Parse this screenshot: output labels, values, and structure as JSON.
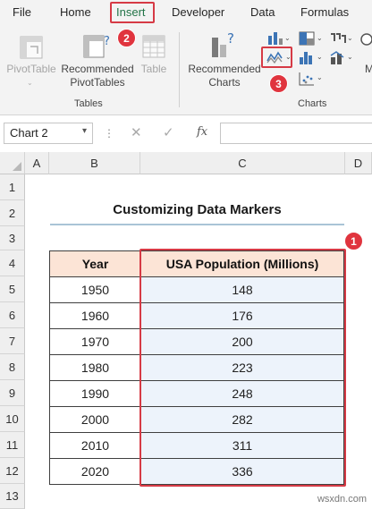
{
  "menu": {
    "items": [
      "File",
      "Home",
      "Insert",
      "Developer",
      "Data",
      "Formulas"
    ],
    "active": "Insert"
  },
  "ribbon": {
    "pivottable": "PivotTable",
    "recommended_pivot_1": "Recommended",
    "recommended_pivot_2": "PivotTables",
    "table": "Table",
    "tables_group": "Tables",
    "recommended_charts_1": "Recommended",
    "recommended_charts_2": "Charts",
    "charts_group": "Charts",
    "cut_off_letter": "M"
  },
  "badges": {
    "one": "1",
    "two": "2",
    "three": "3"
  },
  "formula_bar": {
    "name_box": "Chart 2",
    "fx": "fx"
  },
  "columns": [
    "A",
    "B",
    "C",
    "D"
  ],
  "rows": [
    "1",
    "2",
    "3",
    "4",
    "5",
    "6",
    "7",
    "8",
    "9",
    "10",
    "11",
    "12",
    "13"
  ],
  "sheet": {
    "title": "Customizing Data Markers",
    "headers": [
      "Year",
      "USA Population (Millions)"
    ],
    "data": [
      {
        "year": "1950",
        "pop": "148"
      },
      {
        "year": "1960",
        "pop": "176"
      },
      {
        "year": "1970",
        "pop": "200"
      },
      {
        "year": "1980",
        "pop": "223"
      },
      {
        "year": "1990",
        "pop": "248"
      },
      {
        "year": "2000",
        "pop": "282"
      },
      {
        "year": "2010",
        "pop": "311"
      },
      {
        "year": "2020",
        "pop": "336"
      }
    ]
  },
  "watermark": "wsxdn.com",
  "colors": {
    "accent_red": "#d63a45",
    "excel_green": "#217346",
    "header_fill": "#fce4d6",
    "data_fill": "#edf3fb"
  }
}
